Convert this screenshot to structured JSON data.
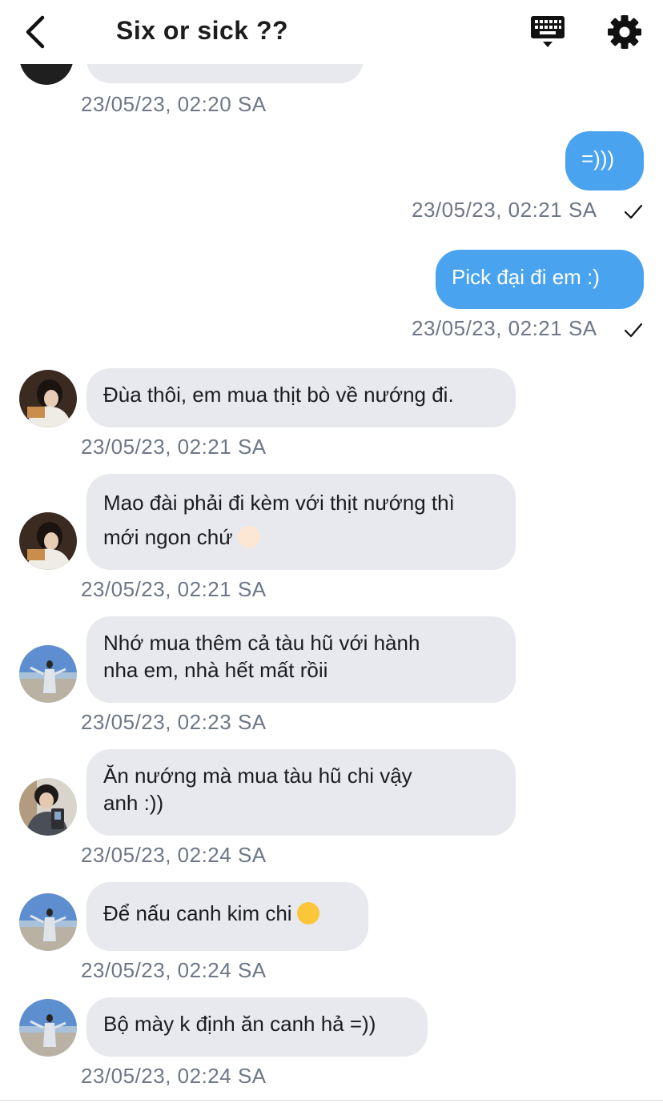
{
  "header": {
    "title": "Six or sick ??",
    "back_icon": "chevron-left-icon",
    "keyboard_icon": "keyboard-icon",
    "settings_icon": "gear-icon"
  },
  "colors": {
    "outgoing_bubble": "#4aa3ef",
    "incoming_bubble": "#e7e9ee",
    "timestamp": "#6e7787"
  },
  "messages": [
    {
      "direction": "in",
      "text": "",
      "timestamp": "23/05/23, 02:20 SA"
    },
    {
      "direction": "out",
      "text": "=)))",
      "timestamp": "23/05/23, 02:21 SA"
    },
    {
      "direction": "out",
      "text": "Pick đại đi em :)",
      "timestamp": "23/05/23, 02:21 SA"
    },
    {
      "direction": "in",
      "text": "Đùa thôi, em mua thịt bò về nướng đi.",
      "timestamp": "23/05/23, 02:21 SA"
    },
    {
      "direction": "in",
      "text_line1": "Mao đài phải đi kèm với thịt nướng thì",
      "text_line2": "mới ngon chứ",
      "emoji": "ok-hand-emoji",
      "timestamp": "23/05/23, 02:21 SA"
    },
    {
      "direction": "in",
      "text": "Nhớ mua thêm cả tàu hũ với hành\nnha em, nhà hết mất rồii",
      "timestamp": "23/05/23, 02:23 SA"
    },
    {
      "direction": "in",
      "text": "Ăn nướng mà mua tàu hũ chi vậy\nanh :))",
      "timestamp": "23/05/23, 02:24 SA"
    },
    {
      "direction": "in",
      "text": "Để nấu canh kim chi",
      "emoji": "kissing-face-emoji",
      "timestamp": "23/05/23, 02:24 SA"
    },
    {
      "direction": "in",
      "text": "Bộ mày k định ăn canh hả =))",
      "timestamp": "23/05/23, 02:24 SA"
    }
  ]
}
